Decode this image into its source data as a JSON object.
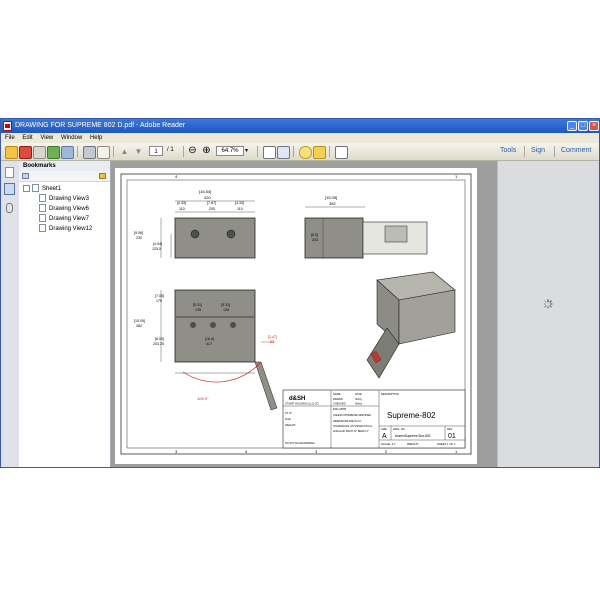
{
  "window": {
    "title": "DRAWING FOR SUPREME 802 D.pdf - Adobe Reader"
  },
  "menu": [
    "File",
    "Edit",
    "View",
    "Window",
    "Help"
  ],
  "toolbar": {
    "page_current": "1",
    "page_total": "/ 1",
    "zoom": "64.7%",
    "tools": "Tools",
    "sign": "Sign",
    "comment": "Comment"
  },
  "bookmarks": {
    "title": "Bookmarks",
    "root": "Sheet1",
    "items": [
      "Drawing View3",
      "Drawing View6",
      "Drawing View7",
      "Drawing View12"
    ]
  },
  "drawing": {
    "dims": {
      "top_width_in": "[16.54]",
      "top_width_mm": "420",
      "hole_left_in": "[4.33]",
      "hole_left_mm": "110",
      "hole_mid_in": "[7.87]",
      "hole_mid_mm": "200",
      "hole_right_in": "[4.33]",
      "hole_right_mm": "110",
      "height_in": "[9.06]",
      "height_mm": "230",
      "hole_h_in": "[4.94]",
      "hole_h_mm": "125.5",
      "side_width_in": "[15.05]",
      "side_width_mm": "382",
      "side_h_in": "[8.0]",
      "side_h_mm": "203",
      "front_h_in": "[7.05]",
      "front_h_mm": "179",
      "front_total_in": "[15.05]",
      "front_total_mm": "382",
      "front_low_in": "[8.00]",
      "front_low_mm": "203.25",
      "f_hole1_in": "[5.31]",
      "f_hole1_mm": "135",
      "f_hole2_in": "[5.31]",
      "f_hole2_mm": "135",
      "front_width_in": "[16.4]",
      "front_width_mm": "417",
      "door_off_in": "[2.47]",
      "door_off_mm": "63",
      "angle": "105.0°"
    },
    "title_block": {
      "company_logo": "d&SH",
      "company": "STUART HOLDINGS (LLC) CO.",
      "part_name": "Supreme-802",
      "size_label": "SIZE",
      "size": "A",
      "dwg_label": "DWG. NO.",
      "dwg_no": "AssemSupreme Box-802",
      "rev_label": "REV",
      "rev": "01",
      "scale": "SCALE: 1:7",
      "weight": "WEIGHT:",
      "sheet": "SHEET 1 OF 1",
      "finish": "finish",
      "material": "ST 37",
      "unless_note": "UNLESS OTHERWISE SPECIFIED:",
      "drawn": "DRAWN",
      "checked": "CHECKED",
      "eng_appr": "ENG APPR.",
      "name_label": "NAME",
      "date_label": "DATE",
      "name": "Visitry",
      "desc_label": "DESCRIPTION",
      "dims_note": "DIMENSIONS ARE IN mm",
      "tolerances": "TOLERANCES: AS SHOWN ON ALL",
      "angular_note": "ANGULAR: MACH ±1° BEND ±1°",
      "footnote": "DO NOT SCALE DRAWING"
    },
    "border": {
      "col_top_left": "4",
      "col_top_right": "1",
      "col_bottom_1": "3",
      "col_bottom_2": "4",
      "col_bottom_3": "3",
      "col_bottom_4": "2",
      "col_bottom_5": "1"
    }
  },
  "colors": {
    "title_bar": "#1f56c4",
    "link": "#2b5ea8",
    "dim_red": "#d22020"
  }
}
